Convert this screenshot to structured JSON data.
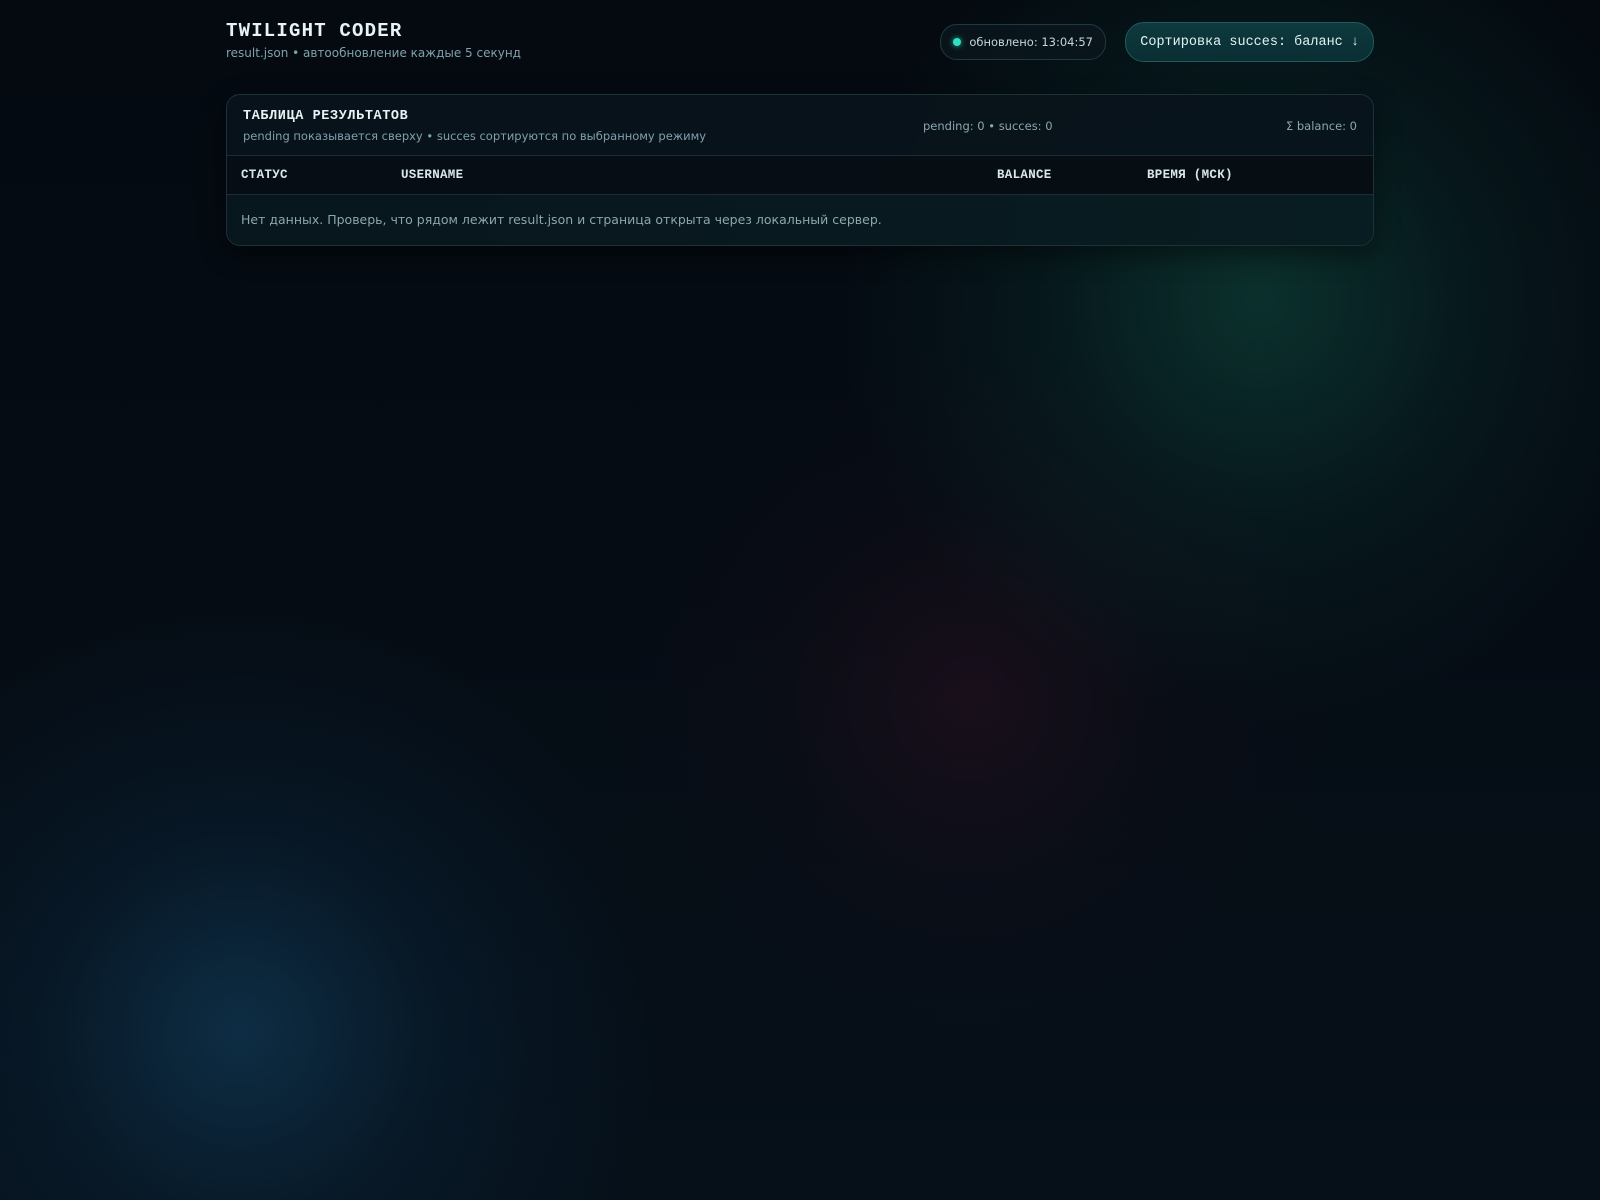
{
  "header": {
    "title": "TWILIGHT CODER",
    "subtitle": "result.json • автообновление каждые 5 секунд",
    "updated_text": "обновлено: 13:04:57",
    "sort_button_label": "Сортировка succes: баланс ↓"
  },
  "panel": {
    "title": "ТАБЛИЦА РЕЗУЛЬТАТОВ",
    "subtitle": "pending показывается сверху • succes сортируются по выбранному режиму",
    "counts": "pending: 0 • succes: 0",
    "sum": "Σ balance: 0"
  },
  "table": {
    "columns": [
      "СТАТУС",
      "USERNAME",
      "BALANCE",
      "ВРЕМЯ (МСК)"
    ],
    "empty_message": "Нет данных. Проверь, что рядом лежит result.json и страница открыта через локальный сервер."
  },
  "colors": {
    "accent": "#2fe0c2",
    "background": "#050c14"
  },
  "icons": {
    "status_dot": "status-dot-icon"
  }
}
